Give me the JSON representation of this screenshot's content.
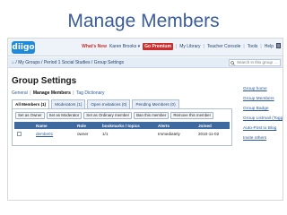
{
  "slide": {
    "title": "Manage Members"
  },
  "topbar": {
    "logo": "diigo",
    "nav": [
      "What's New",
      "Karen Brooks ▾",
      "Go Premium",
      "My Library",
      "Teacher Console",
      "Tools",
      "Help"
    ],
    "sign_out_icon": "door-icon"
  },
  "breadcrumb": {
    "home": "⌂",
    "items": [
      "My Groups",
      "Period 1 Social Studies",
      "Group Settings"
    ],
    "separator": "/"
  },
  "search": {
    "placeholder": "Search in this group ..."
  },
  "page": {
    "title": "Group Settings",
    "subnav": [
      "General",
      "Manage Members",
      "Tag Dictionary"
    ],
    "subnav_current": "Manage Members"
  },
  "tabs": [
    {
      "label": "All Members (1)",
      "active": true
    },
    {
      "label": "Moderators (1)",
      "active": false
    },
    {
      "label": "Open Invitations (0)",
      "active": false
    },
    {
      "label": "Pending Members (0)",
      "active": false
    }
  ],
  "actions": [
    "Set as Owner",
    "Set as Moderator",
    "Set as Ordinary member",
    "Ban this member",
    "Remove this member"
  ],
  "table": {
    "columns": [
      "Name",
      "Role",
      "bookmarks / topics",
      "Alerts",
      "Joined"
    ],
    "rows": [
      {
        "name": "dembe01",
        "role": "owner",
        "bookmarks": "1/1",
        "alerts": "Immediately",
        "joined": "2010-11-02"
      }
    ]
  },
  "sidebar": {
    "links": [
      "Group home",
      "Group Members",
      "Group Badge",
      "Group Listmail (Toggle)",
      "Auto-Post to Blog",
      "Invite others"
    ]
  },
  "colors": {
    "title": "#3b5c9c",
    "header": "#3f6aa0",
    "premium": "#cc2d2d"
  }
}
